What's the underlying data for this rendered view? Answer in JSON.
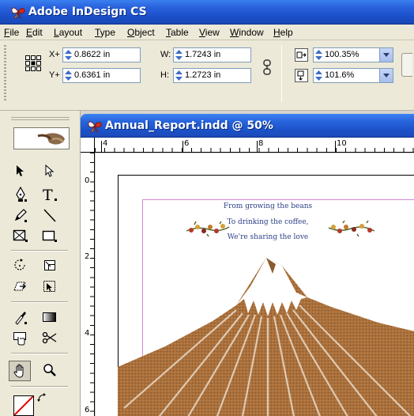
{
  "app": {
    "title": "Adobe InDesign CS"
  },
  "menu": [
    "File",
    "Edit",
    "Layout",
    "Type",
    "Object",
    "Table",
    "View",
    "Window",
    "Help"
  ],
  "control": {
    "x_label": "X+",
    "x_value": "0.8622 in",
    "y_label": "Y+",
    "y_value": "0.6361 in",
    "w_label": "W:",
    "w_value": "1.7243 in",
    "h_label": "H:",
    "h_value": "1.2723 in",
    "scale_x": "100.35%",
    "scale_y": "101.6%"
  },
  "document": {
    "title": "Annual_Report.indd @ 50%",
    "hruler_labels": [
      "4",
      "6",
      "8",
      "10"
    ],
    "vruler_labels": [
      "0",
      "2",
      "4",
      "6"
    ],
    "poem_lines": [
      "From growing the beans",
      "To drinking the coffee,",
      "We're sharing the love"
    ]
  },
  "colors": {
    "title_blue": "#2763dc",
    "poem_text": "#2c3f86",
    "mountain": "#a9703c",
    "snow": "#ffffff"
  },
  "icons": {
    "app": "indesign-butterfly-icon",
    "reference_point": "reference-point-icon",
    "link": "constrain-proportions-icon"
  }
}
